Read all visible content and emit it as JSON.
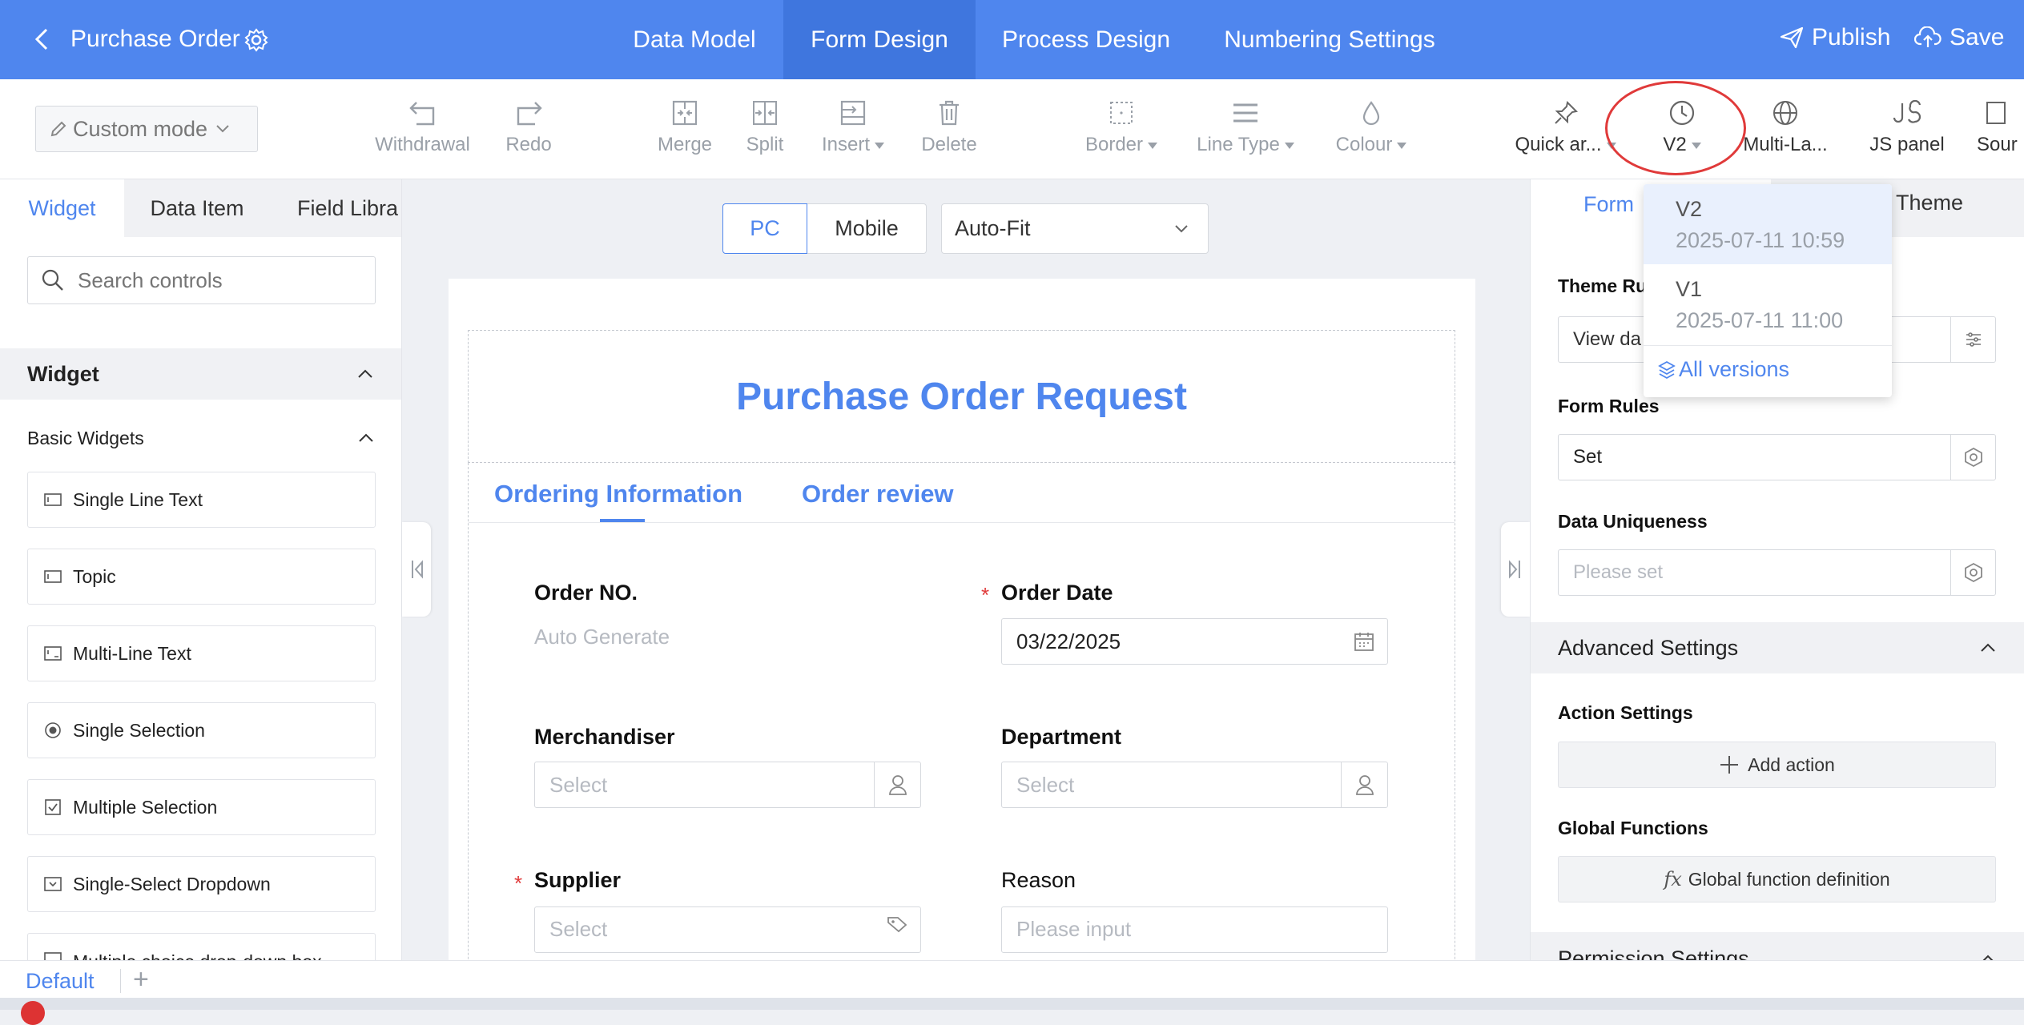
{
  "header": {
    "title": "Purchase Order",
    "tabs": [
      "Data Model",
      "Form Design",
      "Process Design",
      "Numbering Settings"
    ],
    "active_tab": "Form Design",
    "publish_label": "Publish",
    "save_label": "Save",
    "accent_color": "#4f86ee",
    "active_tab_color": "#3f76de"
  },
  "toolbar": {
    "mode_label": "Custom mode",
    "withdrawal": "Withdrawal",
    "redo": "Redo",
    "merge": "Merge",
    "split": "Split",
    "insert": "Insert",
    "delete": "Delete",
    "border": "Border",
    "line_type": "Line Type",
    "colour": "Colour",
    "quick": "Quick ar...",
    "version": "V2",
    "multi_lang": "Multi-La...",
    "js_panel": "JS panel",
    "source": "Sour"
  },
  "version_menu": {
    "items": [
      {
        "name": "V2",
        "date": "2025-07-11 10:59"
      },
      {
        "name": "V1",
        "date": "2025-07-11 11:00"
      }
    ],
    "all_versions": "All versions",
    "highlight_color": "#e03a3a"
  },
  "left_panel": {
    "tabs": [
      "Widget",
      "Data Item",
      "Field Libra"
    ],
    "search_placeholder": "Search controls",
    "section_title": "Widget",
    "group_title": "Basic Widgets",
    "widgets": [
      "Single Line Text",
      "Topic",
      "Multi-Line Text",
      "Single Selection",
      "Multiple Selection",
      "Single-Select Dropdown",
      "Multiple choice drop-down box"
    ]
  },
  "canvas": {
    "device_pc": "PC",
    "device_mobile": "Mobile",
    "fit_value": "Auto-Fit",
    "form_title": "Purchase Order Request",
    "form_tabs": [
      "Ordering Information",
      "Order review"
    ],
    "fields": {
      "order_no_label": "Order NO.",
      "order_no_value": "Auto Generate",
      "order_date_label": "Order Date",
      "order_date_value": "03/22/2025",
      "merchandiser_label": "Merchandiser",
      "merchandiser_placeholder": "Select",
      "department_label": "Department",
      "department_placeholder": "Select",
      "supplier_label": "Supplier",
      "supplier_placeholder": "Select",
      "reason_label": "Reason",
      "reason_placeholder": "Please input"
    }
  },
  "right_panel": {
    "tabs": [
      "Form",
      "Theme"
    ],
    "theme_rules_label": "Theme Ru",
    "theme_rules_value": "View da",
    "form_rules_label": "Form Rules",
    "form_rules_value": "Set",
    "data_uniqueness_label": "Data Uniqueness",
    "data_uniqueness_placeholder": "Please set",
    "advanced_settings": "Advanced Settings",
    "action_settings": "Action Settings",
    "add_action": "Add action",
    "global_functions": "Global Functions",
    "global_fx": "fx",
    "global_function_definition": "Global function definition",
    "permission_settings": "Permission Settings"
  },
  "footer": {
    "default_tab": "Default",
    "add_tab": "+"
  }
}
